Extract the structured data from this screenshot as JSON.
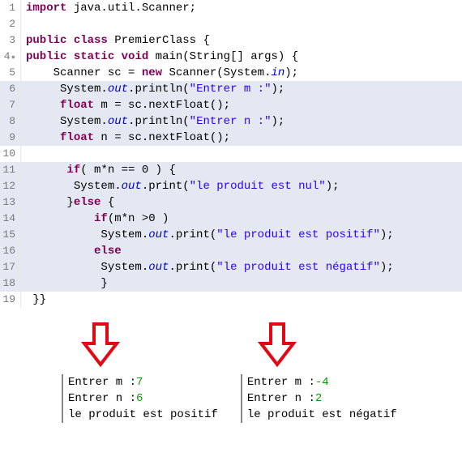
{
  "code": {
    "lines": [
      {
        "n": "1",
        "hl": false
      },
      {
        "n": "2",
        "hl": false
      },
      {
        "n": "3",
        "hl": false
      },
      {
        "n": "4",
        "hl": false,
        "marker": "●"
      },
      {
        "n": "5",
        "hl": false
      },
      {
        "n": "6",
        "hl": true
      },
      {
        "n": "7",
        "hl": true
      },
      {
        "n": "8",
        "hl": true
      },
      {
        "n": "9",
        "hl": true
      },
      {
        "n": "10",
        "hl": false
      },
      {
        "n": "11",
        "hl": true
      },
      {
        "n": "12",
        "hl": true
      },
      {
        "n": "13",
        "hl": true
      },
      {
        "n": "14",
        "hl": true
      },
      {
        "n": "15",
        "hl": true
      },
      {
        "n": "16",
        "hl": true
      },
      {
        "n": "17",
        "hl": true
      },
      {
        "n": "18",
        "hl": true
      },
      {
        "n": "19",
        "hl": false
      }
    ],
    "tokens": {
      "l1": {
        "kw_import": "import",
        "rest": " java.util.Scanner;"
      },
      "l3": {
        "kw_public": "public",
        "kw_class": "class",
        "name": " PremierClass {"
      },
      "l4": {
        "kw_public": "public",
        "kw_static": "static",
        "kw_void": "void",
        "main": " main(String[] args) {"
      },
      "l5": {
        "indent": "    ",
        "txt1": "Scanner sc = ",
        "kw_new": "new",
        "txt2": " Scanner(System.",
        "field_in": "in",
        "txt3": ");"
      },
      "l6": {
        "indent": "     ",
        "txt1": "System.",
        "field_out": "out",
        "txt2": ".println(",
        "str": "\"Entrer m :\"",
        "txt3": ");"
      },
      "l7": {
        "indent": "     ",
        "kw_float": "float",
        "txt": " m = sc.nextFloat();"
      },
      "l8": {
        "indent": "     ",
        "txt1": "System.",
        "field_out": "out",
        "txt2": ".println(",
        "str": "\"Entrer n :\"",
        "txt3": ");"
      },
      "l9": {
        "indent": "     ",
        "kw_float": "float",
        "txt": " n = sc.nextFloat();"
      },
      "l11": {
        "indent": "      ",
        "kw_if": "if",
        "txt": "( m*n == 0 ) {"
      },
      "l12": {
        "indent": "       ",
        "txt1": "System.",
        "field_out": "out",
        "txt2": ".print(",
        "str": "\"le produit est nul\"",
        "txt3": ");"
      },
      "l13": {
        "indent": "      }",
        "kw_else": "else",
        "txt": " {"
      },
      "l14": {
        "indent": "          ",
        "kw_if": "if",
        "txt": "(m*n >0 )"
      },
      "l15": {
        "indent": "           ",
        "txt1": "System.",
        "field_out": "out",
        "txt2": ".print(",
        "str": "\"le produit est positif\"",
        "txt3": ");"
      },
      "l16": {
        "indent": "          ",
        "kw_else": "else"
      },
      "l17": {
        "indent": "           ",
        "txt1": "System.",
        "field_out": "out",
        "txt2": ".print(",
        "str": "\"le produit est négatif\"",
        "txt3": ");"
      },
      "l18": {
        "indent": "           }"
      },
      "l19": {
        "txt": " }}"
      }
    }
  },
  "console1": {
    "p1": "Entrer m :",
    "v1": "7",
    "p2": "Entrer n :",
    "v2": "6",
    "result": "le produit est positif"
  },
  "console2": {
    "p1": "Entrer m :",
    "v1": "-4",
    "p2": "Entrer n :",
    "v2": "2",
    "result": "le produit est négatif"
  }
}
